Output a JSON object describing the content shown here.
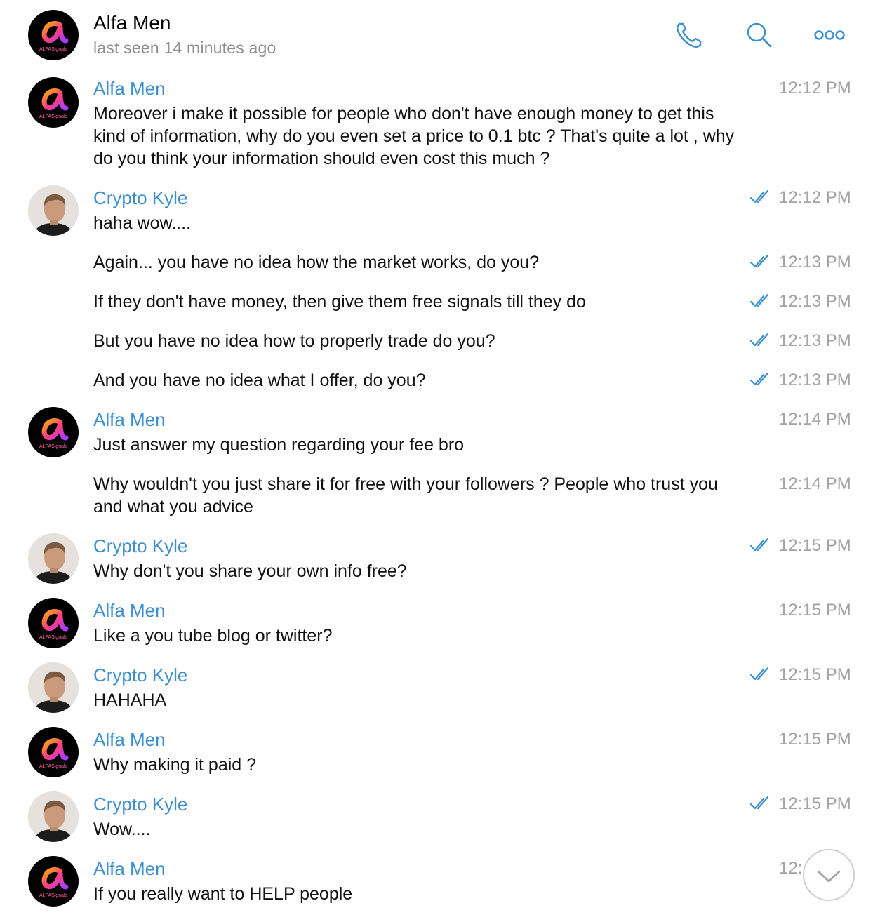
{
  "header": {
    "name": "Alfa Men",
    "status": "last seen 14 minutes ago",
    "avatar_text": "ALFASignals"
  },
  "colors": {
    "accent": "#3d8fcf",
    "time_gray": "#a2a2a7",
    "text": "#111111"
  },
  "icons": [
    "phone-icon",
    "search-icon",
    "more-icon",
    "double-check-icon",
    "chevron-down-icon"
  ],
  "messages": [
    {
      "sender": "Alfa Men",
      "text": "Moreover i make it possible for people who don't have enough money to get this kind of information, why do you even set a price to 0.1 btc ? That's quite a lot  , why do you think your information should even cost this much ?",
      "time": "12:12 PM"
    },
    {
      "sender": "Crypto Kyle",
      "text": "haha wow....",
      "time": "12:12 PM"
    },
    {
      "text": "Again... you have no idea how the market works, do you?",
      "time": "12:13 PM"
    },
    {
      "text": "If they don't have money, then give them free signals till they do",
      "time": "12:13 PM"
    },
    {
      "text": "But you have no idea how to properly trade do you?",
      "time": "12:13 PM"
    },
    {
      "text": "And you have no idea what I offer, do you?",
      "time": "12:13 PM"
    },
    {
      "sender": "Alfa Men",
      "text": "Just answer my question regarding your fee bro",
      "time": "12:14 PM"
    },
    {
      "text": "Why wouldn't you just share it for free with your followers ? People who trust you and what you advice",
      "time": "12:14 PM"
    },
    {
      "sender": "Crypto Kyle",
      "text": "Why don't you share your own info free?",
      "time": "12:15 PM"
    },
    {
      "sender": "Alfa Men",
      "text": "Like a you tube blog or twitter?",
      "time": "12:15 PM"
    },
    {
      "sender": "Crypto Kyle",
      "text": "HAHAHA",
      "time": "12:15 PM"
    },
    {
      "sender": "Alfa Men",
      "text": "Why making it paid ?",
      "time": "12:15 PM"
    },
    {
      "sender": "Crypto Kyle",
      "text": "Wow....",
      "time": "12:15 PM"
    },
    {
      "sender": "Alfa Men",
      "text": "If you really want to HELP people",
      "time": "12:15 PM"
    }
  ]
}
